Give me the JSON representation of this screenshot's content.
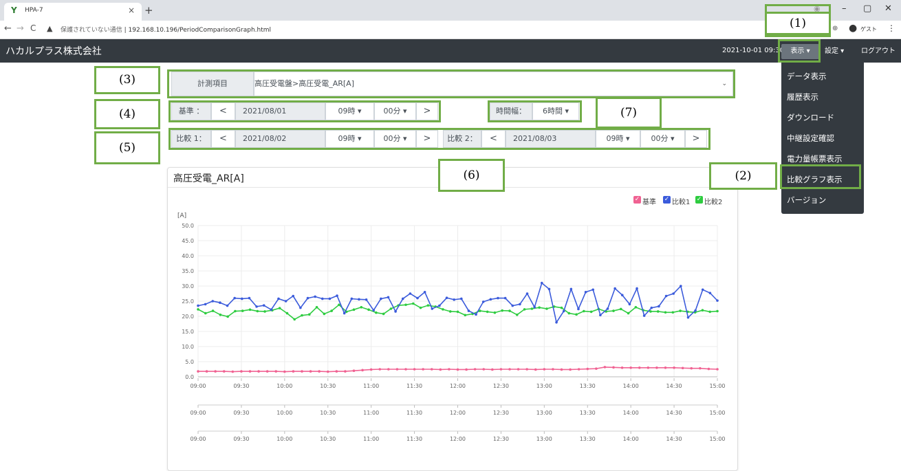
{
  "browser": {
    "tab_title": "HPA-7",
    "tab_close": "×",
    "new_tab": "+",
    "security": "保護されていない通信",
    "url": "192.168.10.196/PeriodComparisonGraph.html",
    "guest": "ゲスト"
  },
  "app": {
    "brand": "ハカルプラス株式会社",
    "datetime": "2021-10-01 09:30",
    "menu_display": "表示 ▾",
    "menu_settings": "設定 ▾",
    "menu_logout": "ログアウト"
  },
  "dropdown": {
    "items": [
      "データ表示",
      "履歴表示",
      "ダウンロード",
      "中継設定確認",
      "電力量帳票表示",
      "比較グラフ表示",
      "バージョン"
    ]
  },
  "annotations": {
    "a1": "(1)",
    "a2": "(2)",
    "a3": "(3)",
    "a4": "(4)",
    "a5": "(5)",
    "a6": "(6)",
    "a7": "(7)"
  },
  "form": {
    "item_label": "計測項目",
    "item_value": "高圧受電盤>高圧受電_AR[A]",
    "base_label": "基準 ：",
    "base_date": "2021/08/01",
    "base_hour": "09時 ▾",
    "base_min": "00分 ▾",
    "width_label": "時間幅：",
    "width_value": "6時間 ▾",
    "cmp1_label": "比較 1：",
    "cmp1_date": "2021/08/02",
    "cmp1_hour": "09時 ▾",
    "cmp1_min": "00分 ▾",
    "cmp2_label": "比較 2：",
    "cmp2_date": "2021/08/03",
    "cmp2_hour": "09時 ▾",
    "cmp2_min": "00分 ▾",
    "prev": "<",
    "next": ">"
  },
  "chart_data": {
    "type": "line",
    "title": "高圧受電_AR[A]",
    "ylabel": "[A]",
    "ylim": [
      0,
      50
    ],
    "yticks": [
      "0.0",
      "5.0",
      "10.0",
      "15.0",
      "20.0",
      "25.0",
      "30.0",
      "35.0",
      "40.0",
      "45.0",
      "50.0"
    ],
    "xticks": [
      "09:00",
      "09:30",
      "10:00",
      "10:30",
      "11:00",
      "11:30",
      "12:00",
      "12:30",
      "13:00",
      "13:30",
      "14:00",
      "14:30",
      "15:00"
    ],
    "legend": [
      "基準",
      "比較1",
      "比較2"
    ],
    "colors": {
      "base": "#f06292",
      "cmp1": "#3b5bdb",
      "cmp2": "#2ecc40"
    },
    "series": [
      {
        "name": "基準",
        "values": [
          1.8,
          1.8,
          1.8,
          1.8,
          1.7,
          1.8,
          1.8,
          1.8,
          1.8,
          1.8,
          1.7,
          1.8,
          1.8,
          1.8,
          1.8,
          1.7,
          1.8,
          1.8,
          2.0,
          2.2,
          2.4,
          2.5,
          2.5,
          2.5,
          2.5,
          2.5,
          2.5,
          2.5,
          2.4,
          2.5,
          2.4,
          2.4,
          2.5,
          2.5,
          2.4,
          2.5,
          2.5,
          2.5,
          2.5,
          2.4,
          2.5,
          2.5,
          2.4,
          2.4,
          2.5,
          2.6,
          2.7,
          3.2,
          3.1,
          3.0,
          3.0,
          3.0,
          3.0,
          3.0,
          3.0,
          3.0,
          2.9,
          2.8,
          2.8,
          2.6,
          2.5
        ]
      },
      {
        "name": "比較1",
        "values": [
          23.5,
          24.0,
          25.0,
          24.5,
          23.5,
          26.0,
          25.8,
          26.0,
          23.2,
          23.6,
          22.2,
          25.8,
          25.0,
          26.7,
          22.8,
          26.0,
          26.5,
          25.8,
          25.8,
          26.8,
          21.0,
          25.8,
          25.6,
          25.5,
          22.0,
          25.8,
          26.3,
          21.6,
          25.8,
          27.5,
          26.0,
          28.0,
          22.5,
          23.5,
          26.1,
          25.5,
          25.8,
          21.8,
          20.6,
          24.8,
          25.6,
          26.0,
          26.0,
          23.5,
          24.0,
          27.5,
          23.0,
          31.0,
          29.0,
          18.0,
          21.7,
          29.0,
          22.4,
          28.0,
          28.8,
          20.4,
          22.5,
          29.2,
          27.0,
          24.0,
          29.2,
          20.2,
          22.8,
          23.3,
          26.7,
          27.5,
          30.0,
          19.6,
          21.9,
          28.8,
          27.7,
          25.2
        ]
      },
      {
        "name": "比較2",
        "values": [
          22.3,
          21.0,
          21.8,
          20.5,
          19.9,
          21.7,
          21.8,
          22.2,
          21.7,
          21.6,
          22.0,
          22.7,
          21.0,
          19.0,
          20.3,
          20.6,
          23.0,
          20.8,
          21.8,
          23.8,
          21.5,
          22.2,
          23.0,
          22.2,
          21.2,
          20.8,
          22.5,
          23.6,
          23.8,
          24.2,
          22.8,
          23.6,
          23.2,
          22.3,
          21.6,
          21.5,
          20.4,
          20.8,
          21.8,
          21.5,
          21.2,
          21.9,
          21.8,
          20.5,
          22.3,
          22.5,
          22.9,
          22.5,
          23.2,
          22.8,
          21.0,
          20.6,
          21.7,
          21.5,
          22.4,
          21.6,
          21.8,
          22.4,
          21.0,
          23.0,
          22.0,
          21.6,
          21.6,
          21.3,
          21.3,
          21.8,
          21.5,
          21.3,
          22.0,
          21.5,
          21.7
        ]
      }
    ]
  }
}
